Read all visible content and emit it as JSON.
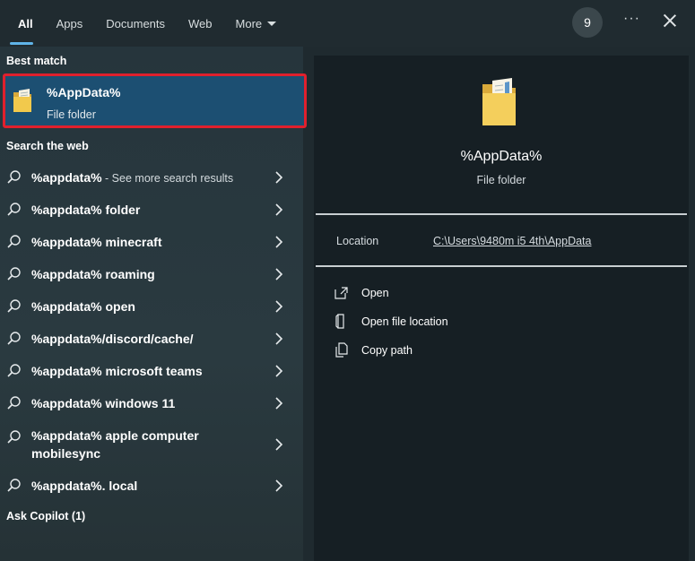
{
  "tabs": [
    {
      "label": "All"
    },
    {
      "label": "Apps"
    },
    {
      "label": "Documents"
    },
    {
      "label": "Web"
    },
    {
      "label": "More"
    }
  ],
  "header": {
    "badge_count": "9",
    "more_options": "···"
  },
  "best_match": {
    "section_title": "Best match",
    "title": "%AppData%",
    "subtitle": "File folder"
  },
  "web": {
    "section_title": "Search the web",
    "results": [
      {
        "text": "%appdata%",
        "suffix": " - See more search results"
      },
      {
        "text": "%appdata% folder"
      },
      {
        "text": "%appdata% minecraft"
      },
      {
        "text": "%appdata% roaming"
      },
      {
        "text": "%appdata% open"
      },
      {
        "text": "%appdata%/discord/cache/"
      },
      {
        "text": "%appdata% microsoft teams"
      },
      {
        "text": "%appdata% windows 11"
      },
      {
        "text": "%appdata% apple computer mobilesync"
      },
      {
        "text": "%appdata%. local"
      }
    ]
  },
  "copilot": {
    "section_title": "Ask Copilot (1)"
  },
  "preview": {
    "title": "%AppData%",
    "subtitle": "File folder",
    "location_label": "Location",
    "location_path": "C:\\Users\\9480m i5 4th\\AppData",
    "actions": [
      {
        "label": "Open",
        "icon": "open-icon"
      },
      {
        "label": "Open file location",
        "icon": "file-location-icon"
      },
      {
        "label": "Copy path",
        "icon": "copy-path-icon"
      }
    ]
  },
  "colors": {
    "accent": "#5fb4e8",
    "selection": "#1c4f72",
    "highlight_border": "#e0202d"
  }
}
